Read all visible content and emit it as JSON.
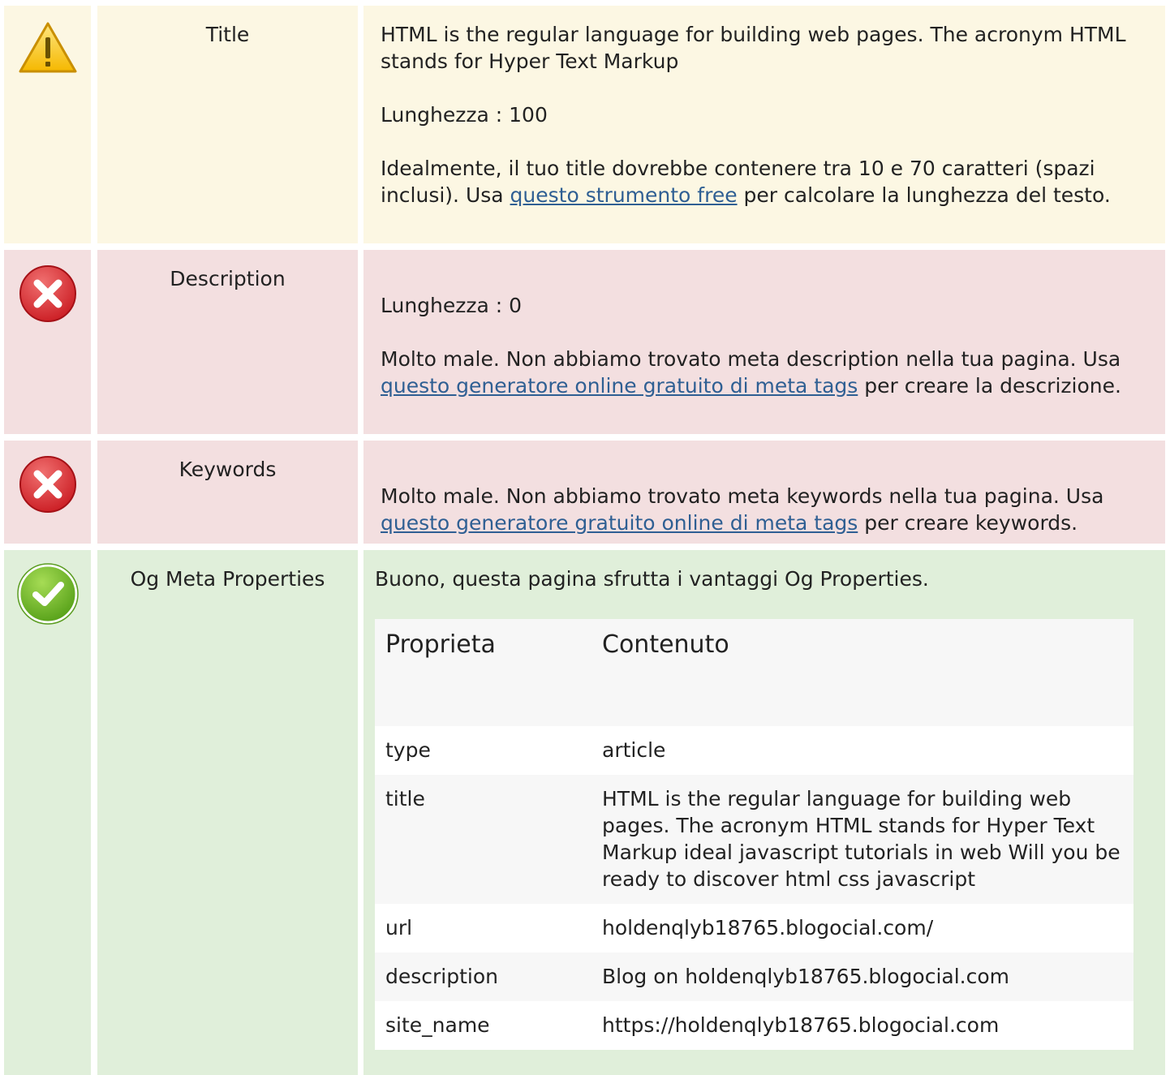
{
  "colors": {
    "warning_bg": "#fcf7e3",
    "error_bg": "#f3dfe0",
    "success_bg": "#e0efda",
    "link": "#2f5f93"
  },
  "rows": {
    "title": {
      "status_icon": "warning-icon",
      "label": "Title",
      "text": "HTML is the regular language for building web pages. The acronym HTML stands for Hyper Text Markup",
      "length": "Lunghezza : 100",
      "advice_pre": "Idealmente, il tuo title dovrebbe contenere tra 10 e 70 caratteri (spazi inclusi). Usa ",
      "advice_link": "questo strumento free",
      "advice_post": " per calcolare la lunghezza del testo."
    },
    "description": {
      "status_icon": "error-icon",
      "label": "Description",
      "length": "Lunghezza : 0",
      "advice_pre": "Molto male. Non abbiamo trovato meta description nella tua pagina. Usa ",
      "advice_link": "questo generatore online gratuito di meta tags",
      "advice_post": " per creare la descrizione."
    },
    "keywords": {
      "status_icon": "error-icon",
      "label": "Keywords",
      "advice_pre": "Molto male. Non abbiamo trovato meta keywords nella tua pagina. Usa ",
      "advice_link": "questo generatore gratuito online di meta tags",
      "advice_post": " per creare keywords."
    },
    "og": {
      "status_icon": "check-icon",
      "label": "Og Meta Properties",
      "text": "Buono, questa pagina sfrutta i vantaggi Og Properties.",
      "table": {
        "headers": [
          "Proprieta",
          "Contenuto"
        ],
        "rows": [
          {
            "property": "type",
            "content": "article"
          },
          {
            "property": "title",
            "content": "HTML is the regular language for building web pages. The acronym HTML stands for Hyper Text Markup ideal javascript tutorials in web Will you be ready to discover html css javascript"
          },
          {
            "property": "url",
            "content": "holdenqlyb18765.blogocial.com/"
          },
          {
            "property": "description",
            "content": "Blog on holdenqlyb18765.blogocial.com"
          },
          {
            "property": "site_name",
            "content": "https://holdenqlyb18765.blogocial.com"
          }
        ]
      }
    }
  }
}
